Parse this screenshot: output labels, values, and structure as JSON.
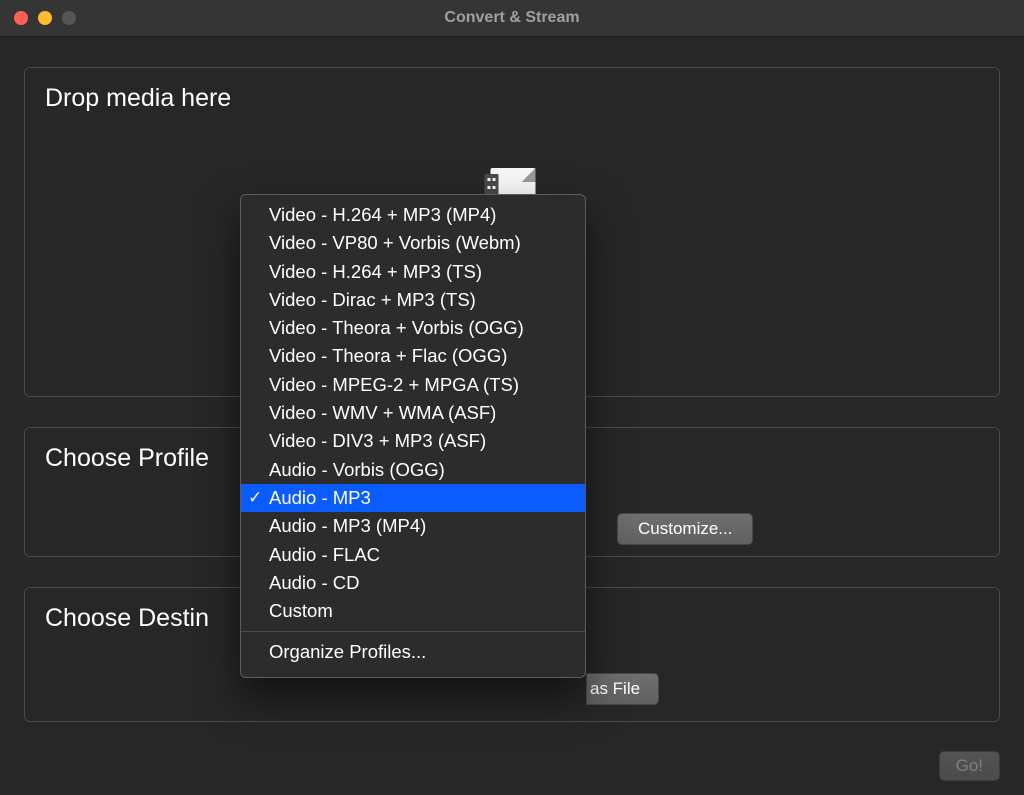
{
  "window": {
    "title": "Convert & Stream"
  },
  "drop": {
    "title": "Drop media here"
  },
  "profile": {
    "title": "Choose Profile",
    "customize_label": "Customize..."
  },
  "destination": {
    "title": "Choose Destin",
    "asfile_label": "as File"
  },
  "go_label": "Go!",
  "popup": {
    "items": [
      {
        "label": "Video - H.264 + MP3 (MP4)",
        "selected": false
      },
      {
        "label": "Video - VP80 + Vorbis (Webm)",
        "selected": false
      },
      {
        "label": "Video - H.264 + MP3 (TS)",
        "selected": false
      },
      {
        "label": "Video - Dirac + MP3 (TS)",
        "selected": false
      },
      {
        "label": "Video - Theora + Vorbis (OGG)",
        "selected": false
      },
      {
        "label": "Video - Theora + Flac (OGG)",
        "selected": false
      },
      {
        "label": "Video - MPEG-2 + MPGA (TS)",
        "selected": false
      },
      {
        "label": "Video - WMV + WMA (ASF)",
        "selected": false
      },
      {
        "label": "Video - DIV3 + MP3 (ASF)",
        "selected": false
      },
      {
        "label": "Audio - Vorbis (OGG)",
        "selected": false
      },
      {
        "label": "Audio - MP3",
        "selected": true
      },
      {
        "label": "Audio - MP3 (MP4)",
        "selected": false
      },
      {
        "label": "Audio - FLAC",
        "selected": false
      },
      {
        "label": "Audio - CD",
        "selected": false
      },
      {
        "label": "Custom",
        "selected": false
      }
    ],
    "organize_label": "Organize Profiles..."
  }
}
